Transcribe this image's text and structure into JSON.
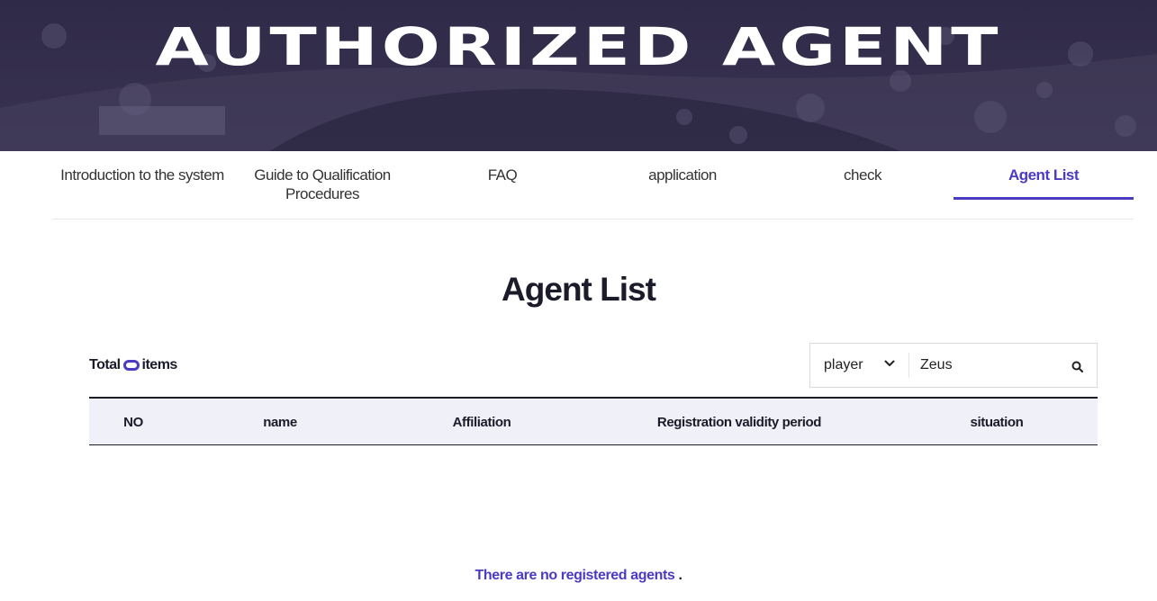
{
  "hero": {
    "title": "AUTHORIZED AGENT"
  },
  "tabs": [
    {
      "label": "Introduction to the system",
      "active": false
    },
    {
      "label": "Guide to Qualification Procedures",
      "active": false
    },
    {
      "label": "FAQ",
      "active": false
    },
    {
      "label": "application",
      "active": false
    },
    {
      "label": "check",
      "active": false
    },
    {
      "label": "Agent List",
      "active": true
    }
  ],
  "page_title": "Agent List",
  "summary": {
    "prefix": "Total",
    "count": "0",
    "suffix": "items"
  },
  "search": {
    "filter_selected": "player",
    "query": "Zeus",
    "icons": {
      "dropdown": "chevron-down-icon",
      "submit": "search-icon"
    }
  },
  "table": {
    "columns": [
      "NO",
      "name",
      "Affiliation",
      "Registration validity period",
      "situation"
    ],
    "rows": []
  },
  "empty_state": {
    "message": "There are no registered agents",
    "punct": "."
  },
  "colors": {
    "accent": "#4b3bc4",
    "hero_bg": "#2a2440",
    "header_row_bg": "#f0f0f8",
    "text": "#1b1b2a"
  }
}
